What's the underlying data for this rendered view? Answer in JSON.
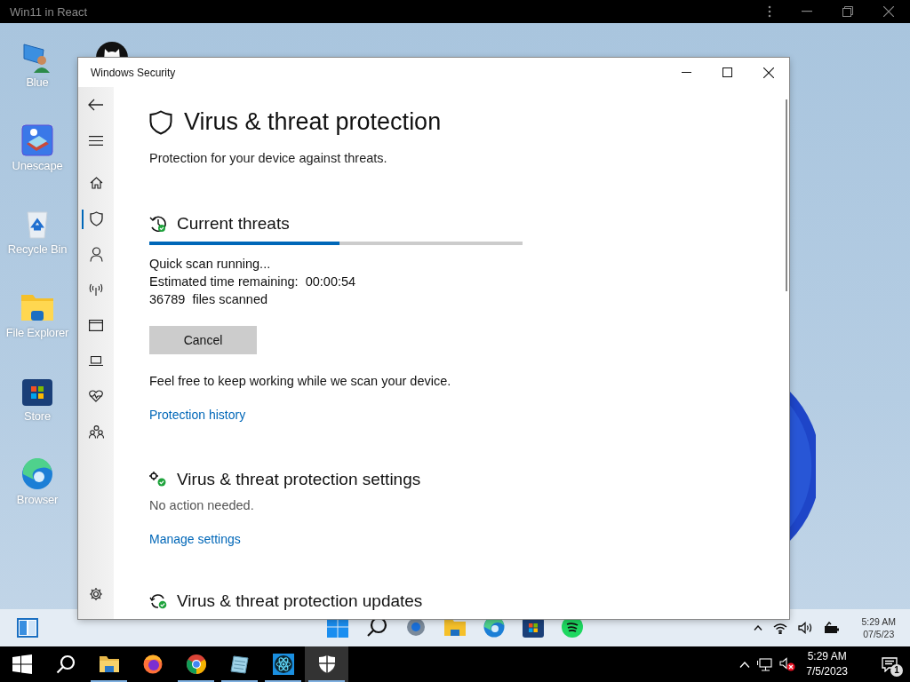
{
  "top_bar": {
    "title": "Win11 in React"
  },
  "desktop_icons": [
    {
      "kind": "user",
      "label": "Blue"
    },
    {
      "kind": "game",
      "label": "Unescape"
    },
    {
      "kind": "recycle",
      "label": "Recycle Bin"
    },
    {
      "kind": "folder",
      "label": "File Explorer"
    },
    {
      "kind": "store",
      "label": "Store"
    },
    {
      "kind": "edge",
      "label": "Browser"
    }
  ],
  "window": {
    "title": "Windows Security",
    "nav_items": [
      {
        "kind": "back",
        "selected": false
      },
      {
        "kind": "menu",
        "selected": false
      },
      {
        "kind": "home",
        "selected": false
      },
      {
        "kind": "shield",
        "selected": true
      },
      {
        "kind": "person",
        "selected": false
      },
      {
        "kind": "wireless",
        "selected": false
      },
      {
        "kind": "browser",
        "selected": false
      },
      {
        "kind": "laptop",
        "selected": false
      },
      {
        "kind": "heart",
        "selected": false
      },
      {
        "kind": "family",
        "selected": false
      },
      {
        "kind": "settings",
        "selected": false
      }
    ],
    "page_title": "Virus & threat protection",
    "page_subtitle": "Protection for your device against threats.",
    "current_threats": {
      "heading": "Current threats",
      "progress": {
        "level": 0.51
      },
      "status_lines": [
        "Quick scan running...",
        "Estimated time remaining:  00:00:54",
        "36789  files scanned"
      ],
      "cancel_button": "Cancel",
      "note": "Feel free to keep working while we scan your device.",
      "link": "Protection history"
    },
    "settings": {
      "heading": "Virus & threat protection settings",
      "status": "No action needed.",
      "link": "Manage settings"
    },
    "updates": {
      "heading": "Virus & threat protection updates"
    }
  },
  "desktop_taskbar": {
    "apps": [
      {
        "kind": "start"
      },
      {
        "kind": "search"
      },
      {
        "kind": "settings"
      },
      {
        "kind": "folder"
      },
      {
        "kind": "edge"
      },
      {
        "kind": "store"
      },
      {
        "kind": "spotify"
      }
    ],
    "clock": {
      "time": "5:29 AM",
      "date": "07/5/23"
    }
  },
  "taskbar": {
    "apps": [
      {
        "kind": "start",
        "running": false,
        "selected": false
      },
      {
        "kind": "search",
        "running": false,
        "selected": false
      },
      {
        "kind": "folder",
        "running": true,
        "selected": false
      },
      {
        "kind": "firefox",
        "running": false,
        "selected": false
      },
      {
        "kind": "chrome",
        "running": true,
        "selected": false
      },
      {
        "kind": "notepad",
        "running": true,
        "selected": false
      },
      {
        "kind": "react",
        "running": true,
        "selected": false
      },
      {
        "kind": "security",
        "running": true,
        "selected": true
      }
    ],
    "clock": {
      "time": "5:29 AM",
      "date": "7/5/2023"
    },
    "notification_count": "1"
  }
}
